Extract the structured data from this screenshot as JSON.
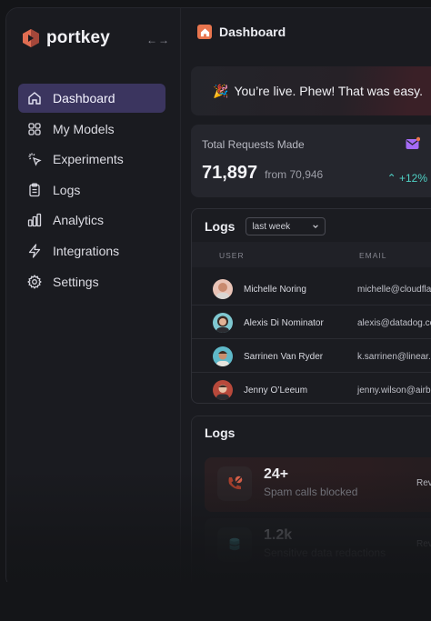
{
  "brand": {
    "name": "portkey",
    "collapse_icon": "arrows-left-right-icon"
  },
  "sidebar": {
    "items": [
      {
        "label": "Dashboard",
        "icon": "home-icon",
        "active": true
      },
      {
        "label": "My Models",
        "icon": "grid-icon",
        "active": false
      },
      {
        "label": "Experiments",
        "icon": "cursor-click-icon",
        "active": false
      },
      {
        "label": "Logs",
        "icon": "clipboard-icon",
        "active": false
      },
      {
        "label": "Analytics",
        "icon": "bar-chart-icon",
        "active": false
      },
      {
        "label": "Integrations",
        "icon": "lightning-icon",
        "active": false
      },
      {
        "label": "Settings",
        "icon": "gear-icon",
        "active": false
      }
    ]
  },
  "header": {
    "title": "Dashboard",
    "icon": "home-icon"
  },
  "banner": {
    "emoji": "🎉",
    "text": "You’re live. Phew! That was easy."
  },
  "stats": {
    "label": "Total Requests Made",
    "value": "71,897",
    "from": "from 70,946",
    "change": "+12%",
    "change_icon": "chevron-up-icon",
    "badge_icon": "mail-icon"
  },
  "logs": {
    "title": "Logs",
    "filter": "last week",
    "columns": [
      "USER",
      "EMAIL"
    ],
    "rows": [
      {
        "name": "Michelle Noring",
        "email": "michelle@cloudfla"
      },
      {
        "name": "Alexis Di Nominator",
        "email": "alexis@datadog.co"
      },
      {
        "name": "Sarrinen Van Ryder",
        "email": "k.sarrinen@linear.a"
      },
      {
        "name": "Jenny O’Leeum",
        "email": "jenny.wilson@airb"
      }
    ]
  },
  "logs2": {
    "title": "Logs",
    "metrics": [
      {
        "value": "24+",
        "label": "Spam calls blocked",
        "action": "Rev",
        "icon": "phone-block-icon"
      },
      {
        "value": "1.2k",
        "label": "Sensitive data redactions",
        "action": "Rev",
        "icon": "database-icon"
      }
    ]
  },
  "colors": {
    "accent": "#3b355f",
    "positive": "#4fd1c5",
    "brand_orange": "#e8754e",
    "mail_purple": "#a46bf5"
  }
}
